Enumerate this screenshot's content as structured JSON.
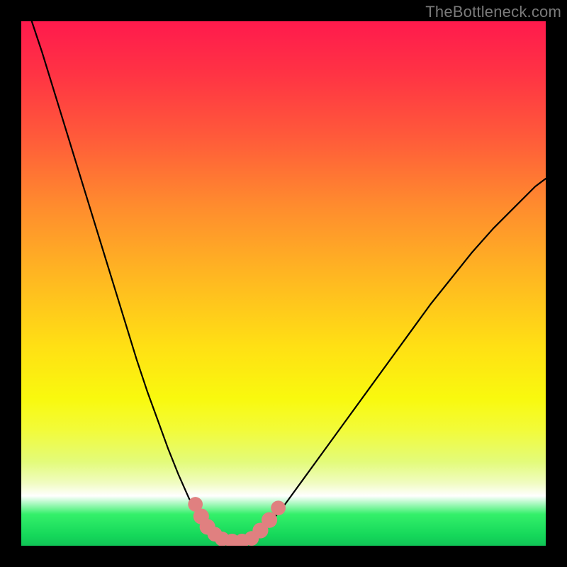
{
  "watermark": "TheBottleneck.com",
  "chart_data": {
    "type": "line",
    "title": "",
    "xlabel": "",
    "ylabel": "",
    "xlim": [
      0,
      100
    ],
    "ylim": [
      0,
      100
    ],
    "series": [
      {
        "name": "left-curve",
        "x": [
          2,
          4,
          6,
          8,
          10,
          12,
          14,
          16,
          18,
          20,
          22,
          24,
          26,
          28,
          30,
          32,
          34,
          36,
          38,
          39
        ],
        "values": [
          100,
          94,
          87.5,
          81,
          74.5,
          68,
          61.5,
          55,
          48.5,
          42,
          35.5,
          29.5,
          24,
          18.5,
          13.5,
          9,
          5.5,
          3,
          1.5,
          1
        ]
      },
      {
        "name": "right-curve",
        "x": [
          43,
          44,
          46,
          48,
          50,
          54,
          58,
          62,
          66,
          70,
          74,
          78,
          82,
          86,
          90,
          94,
          98,
          100
        ],
        "values": [
          1,
          1.5,
          3,
          5,
          7.5,
          13,
          18.5,
          24,
          29.5,
          35,
          40.5,
          46,
          51,
          56,
          60.5,
          64.5,
          68.5,
          70
        ]
      },
      {
        "name": "bottom-bridge",
        "x": [
          39,
          40,
          41,
          42,
          43
        ],
        "values": [
          1,
          0.5,
          0.5,
          0.5,
          1
        ]
      }
    ],
    "markers": [
      {
        "name": "left-top",
        "x": 33.2,
        "y": 7.9,
        "r": 1.4
      },
      {
        "name": "left-a",
        "x": 34.3,
        "y": 5.6,
        "r": 1.5
      },
      {
        "name": "left-b",
        "x": 35.5,
        "y": 3.6,
        "r": 1.5
      },
      {
        "name": "left-c",
        "x": 36.9,
        "y": 2.2,
        "r": 1.4
      },
      {
        "name": "bot-a",
        "x": 38.3,
        "y": 1.3,
        "r": 1.4
      },
      {
        "name": "bot-b",
        "x": 40.2,
        "y": 0.9,
        "r": 1.4
      },
      {
        "name": "bot-c",
        "x": 42.1,
        "y": 0.9,
        "r": 1.4
      },
      {
        "name": "bot-d",
        "x": 43.9,
        "y": 1.4,
        "r": 1.4
      },
      {
        "name": "right-a",
        "x": 45.6,
        "y": 2.9,
        "r": 1.5
      },
      {
        "name": "right-b",
        "x": 47.3,
        "y": 4.9,
        "r": 1.5
      },
      {
        "name": "right-top",
        "x": 49.0,
        "y": 7.2,
        "r": 1.4
      }
    ],
    "marker_color": "#e08080",
    "curve_color": "#000000"
  },
  "colors": {
    "frame": "#000000",
    "watermark": "#7a7a7a"
  }
}
